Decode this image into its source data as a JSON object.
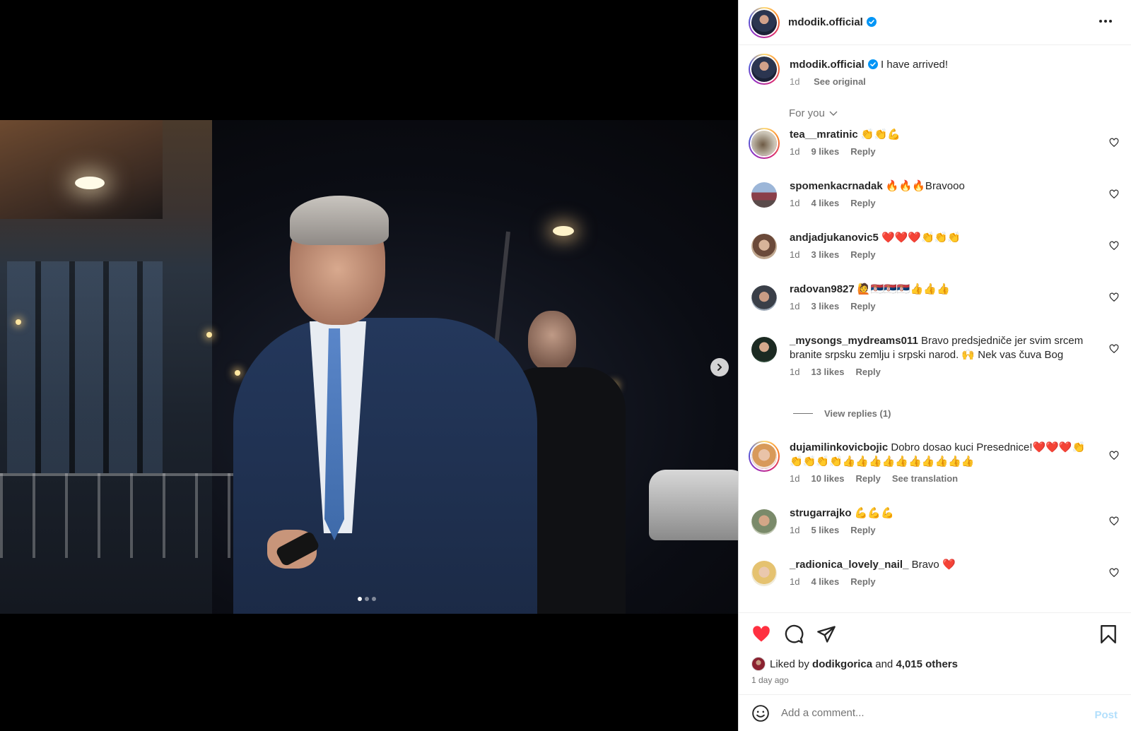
{
  "post": {
    "username": "mdodik.official",
    "caption": "I have arrived!",
    "caption_age": "1d",
    "see_original": "See original",
    "media_count": 3,
    "media_index": 1
  },
  "sort": {
    "label": "For you"
  },
  "comments": [
    {
      "user": "tea__mratinic",
      "text": "👏👏💪",
      "age": "1d",
      "likes": "9 likes",
      "reply": "Reply"
    },
    {
      "user": "spomenkacrnadak",
      "text": "🔥🔥🔥Bravooo",
      "age": "1d",
      "likes": "4 likes",
      "reply": "Reply"
    },
    {
      "user": "andjadjukanovic5",
      "text": "❤️❤️❤️👏👏👏",
      "age": "1d",
      "likes": "3 likes",
      "reply": "Reply"
    },
    {
      "user": "radovan9827",
      "text": "🙋🇷🇸🇷🇸🇷🇸👍👍👍",
      "age": "1d",
      "likes": "3 likes",
      "reply": "Reply"
    },
    {
      "user": "_mysongs_mydreams011",
      "text": "Bravo predsjedniče jer svim srcem branite srpsku zemlju i srpski narod. 🙌 Nek vas čuva Bog",
      "age": "1d",
      "likes": "13 likes",
      "reply": "Reply",
      "view_replies": "View replies (1)"
    },
    {
      "user": "dujamilinkovicbojic",
      "text": "Dobro dosao kuci Presednice!❤️❤️❤️👏👏👏👏👏👍👍👍👍👍👍👍👍👍👍",
      "age": "1d",
      "likes": "10 likes",
      "reply": "Reply",
      "translate": "See translation"
    },
    {
      "user": "strugarrajko",
      "text": "💪💪💪",
      "age": "1d",
      "likes": "5 likes",
      "reply": "Reply"
    },
    {
      "user": "_radionica_lovely_nail_",
      "text": "Bravo ❤️",
      "age": "1d",
      "likes": "4 likes",
      "reply": "Reply"
    }
  ],
  "likes": {
    "prefix": "Liked by",
    "user": "dodikgorica",
    "conj": "and",
    "others": "4,015 others",
    "time": "1 day ago"
  },
  "composer": {
    "placeholder": "Add a comment...",
    "post_label": "Post"
  },
  "colors": {
    "like_red": "#ff3040",
    "verified_blue": "#0095f6",
    "post_disabled": "#b2dffc"
  }
}
